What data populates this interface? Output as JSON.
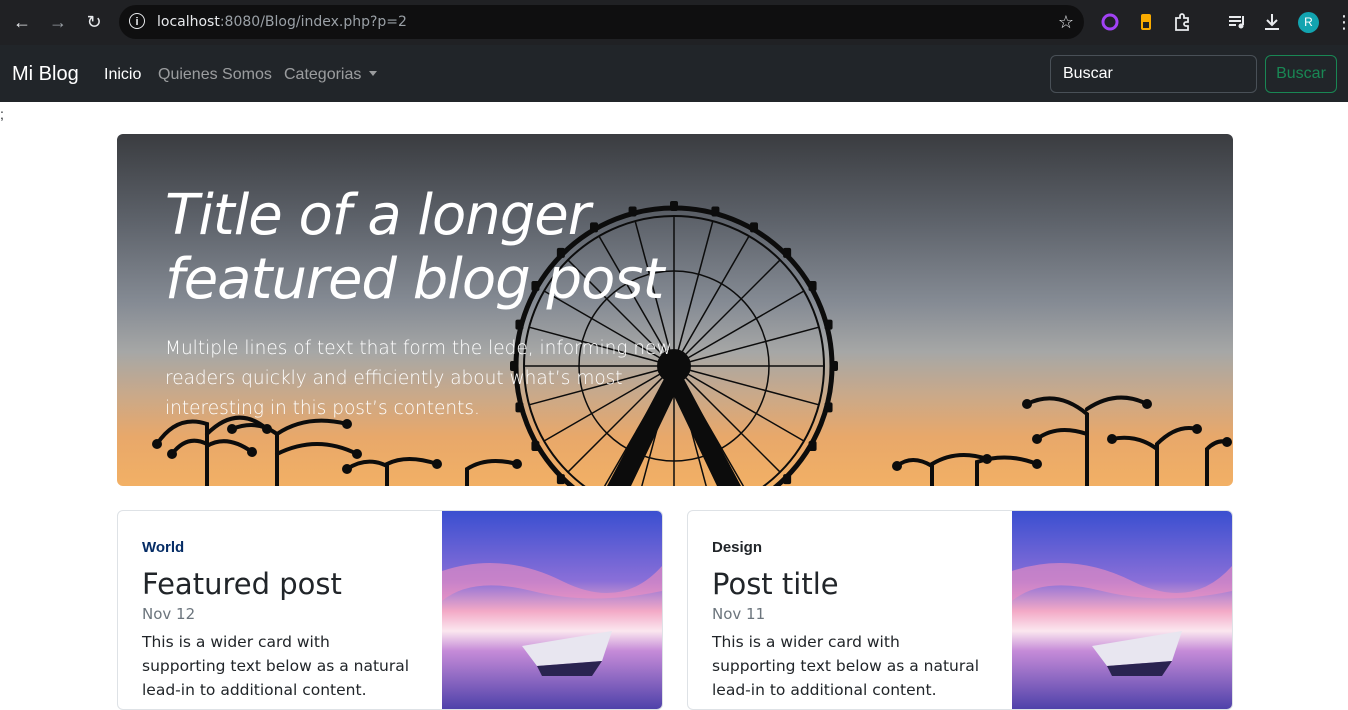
{
  "browser": {
    "url_host": "localhost",
    "url_rest": ":8080/Blog/index.php?p=2",
    "profile_initial": "R"
  },
  "navbar": {
    "brand": "Mi Blog",
    "links": [
      {
        "label": "Inicio",
        "active": true
      },
      {
        "label": "Quienes Somos",
        "active": false
      },
      {
        "label": "Categorias",
        "active": false
      }
    ],
    "search_placeholder": "Buscar",
    "search_button": "Buscar"
  },
  "stray_text": ";",
  "hero": {
    "title": "Title of a longer featured blog post",
    "lede": "Multiple lines of text that form the lede, informing new readers quickly and efficiently about what’s most interesting in this post’s contents."
  },
  "cards": [
    {
      "category": "World",
      "category_color": "#052c65",
      "title": "Featured post",
      "date": "Nov 12",
      "text": "This is a wider card with supporting text below as a natural lead-in to additional content."
    },
    {
      "category": "Design",
      "category_color": "#212529",
      "title": "Post title",
      "date": "Nov 11",
      "text": "This is a wider card with supporting text below as a natural lead-in to additional content."
    }
  ]
}
